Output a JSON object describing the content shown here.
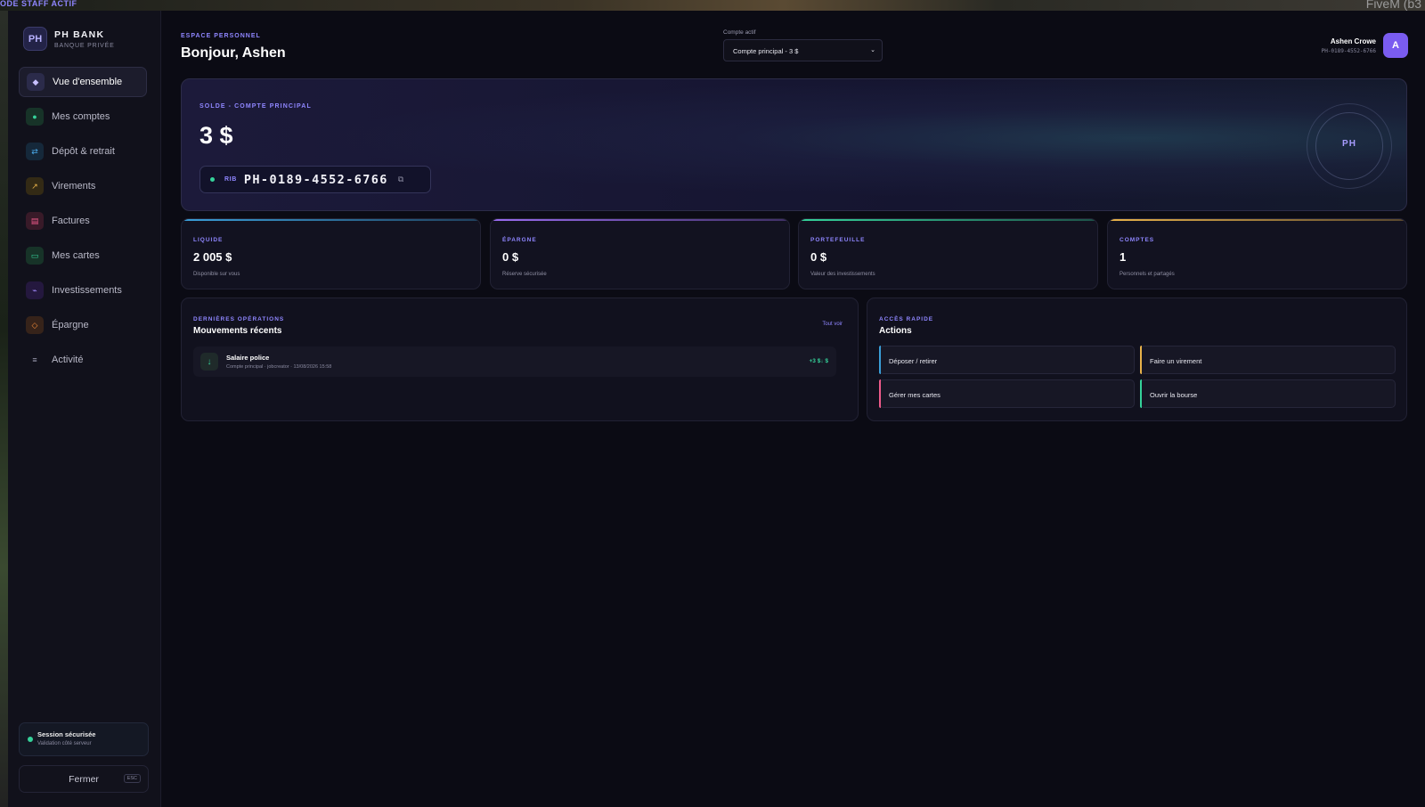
{
  "background": {
    "staff_mode": "ODE STAFF ACTIF",
    "fivem": "FiveM (b3"
  },
  "sidebar": {
    "logo": "PH",
    "brand_name": "PH BANK",
    "brand_sub": "BANQUE PRIVÉE",
    "items": [
      {
        "label": "Vue d'ensemble",
        "icon": "◆",
        "color": "#c8c0ff",
        "bg": "#2b2b4a"
      },
      {
        "label": "Mes comptes",
        "icon": "●",
        "color": "#35d29a",
        "bg": "#173328"
      },
      {
        "label": "Dépôt & retrait",
        "icon": "⇄",
        "color": "#4aa8e8",
        "bg": "#15283a"
      },
      {
        "label": "Virements",
        "icon": "↗",
        "color": "#e8b24a",
        "bg": "#332a15"
      },
      {
        "label": "Factures",
        "icon": "▤",
        "color": "#ee5a8a",
        "bg": "#381a28"
      },
      {
        "label": "Mes cartes",
        "icon": "▭",
        "color": "#35d29a",
        "bg": "#173328"
      },
      {
        "label": "Investissements",
        "icon": "⌁",
        "color": "#a48cff",
        "bg": "#24183e"
      },
      {
        "label": "Épargne",
        "icon": "◇",
        "color": "#f08a3a",
        "bg": "#36231a"
      },
      {
        "label": "Activité",
        "icon": "≡",
        "color": "#a0a0b4",
        "bg": "transparent"
      }
    ],
    "session_title": "Session sécurisée",
    "session_sub": "Validation côté serveur",
    "close_label": "Fermer",
    "esc": "ESC"
  },
  "header": {
    "kicker": "ESPACE PERSONNEL",
    "title": "Bonjour, Ashen",
    "select_label": "Compte actif",
    "select_value": "Compte principal - 3 $",
    "user_name": "Ashen Crowe",
    "user_id": "PH-0189-4552-6766",
    "avatar": "A"
  },
  "hero": {
    "kicker": "SOLDE - COMPTE PRINCIPAL",
    "amount": "3 $",
    "rib_label": "RIB",
    "rib_value": "PH-0189-4552-6766",
    "emblem": "PH"
  },
  "stats": [
    {
      "label": "LIQUIDE",
      "value": "2 005 $",
      "desc": "Disponible sur vous",
      "accent": "#3a9ed8"
    },
    {
      "label": "ÉPARGNE",
      "value": "0 $",
      "desc": "Réserve sécurisée",
      "accent": "#9a6cf0"
    },
    {
      "label": "PORTEFEUILLE",
      "value": "0 $",
      "desc": "Valeur des investissements",
      "accent": "#35d29a"
    },
    {
      "label": "COMPTES",
      "value": "1",
      "desc": "Personnels et partagés",
      "accent": "#e8b24a"
    }
  ],
  "recent": {
    "kicker": "DERNIÈRES OPÉRATIONS",
    "title": "Mouvements récents",
    "see_all": "Tout voir",
    "items": [
      {
        "icon": "↓",
        "title": "Salaire police",
        "sub": "Compte principal · jobcreator · 13/08/2026 15:58",
        "amount": "+3 $↓ $"
      }
    ]
  },
  "quick": {
    "kicker": "ACCÈS RAPIDE",
    "title": "Actions",
    "actions": [
      {
        "label": "Déposer / retirer",
        "accent": "#3a9ed8"
      },
      {
        "label": "Faire un virement",
        "accent": "#e8b24a"
      },
      {
        "label": "Gérer mes cartes",
        "accent": "#ee5a8a"
      },
      {
        "label": "Ouvrir la bourse",
        "accent": "#35d29a"
      }
    ]
  }
}
